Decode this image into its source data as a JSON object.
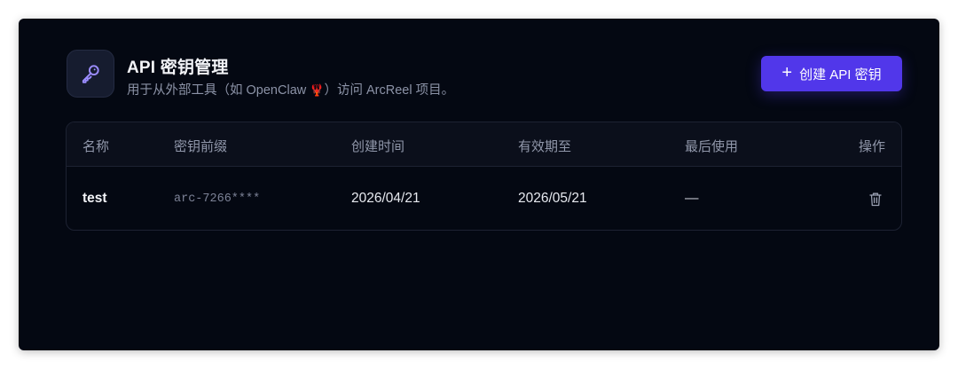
{
  "header": {
    "title": "API 密钥管理",
    "subtitle_prefix": "用于从外部工具（如 OpenClaw ",
    "subtitle_emoji": "🦞",
    "subtitle_suffix": "）访问 ArcReel 项目。",
    "icon": "key-icon"
  },
  "create_button": {
    "icon": "plus-icon",
    "label": "创建 API 密钥"
  },
  "table": {
    "columns": [
      "名称",
      "密钥前缀",
      "创建时间",
      "有效期至",
      "最后使用",
      "操作"
    ],
    "rows": [
      {
        "name": "test",
        "prefix": "arc-7266****",
        "created": "2026/04/21",
        "expires": "2026/05/21",
        "last_used": "—",
        "action_icon": "trash-icon"
      }
    ]
  },
  "colors": {
    "panel_bg": "#040812",
    "accent": "#5137ea",
    "header_row_bg": "#0b0f1b",
    "muted_text": "#8c93a7"
  }
}
